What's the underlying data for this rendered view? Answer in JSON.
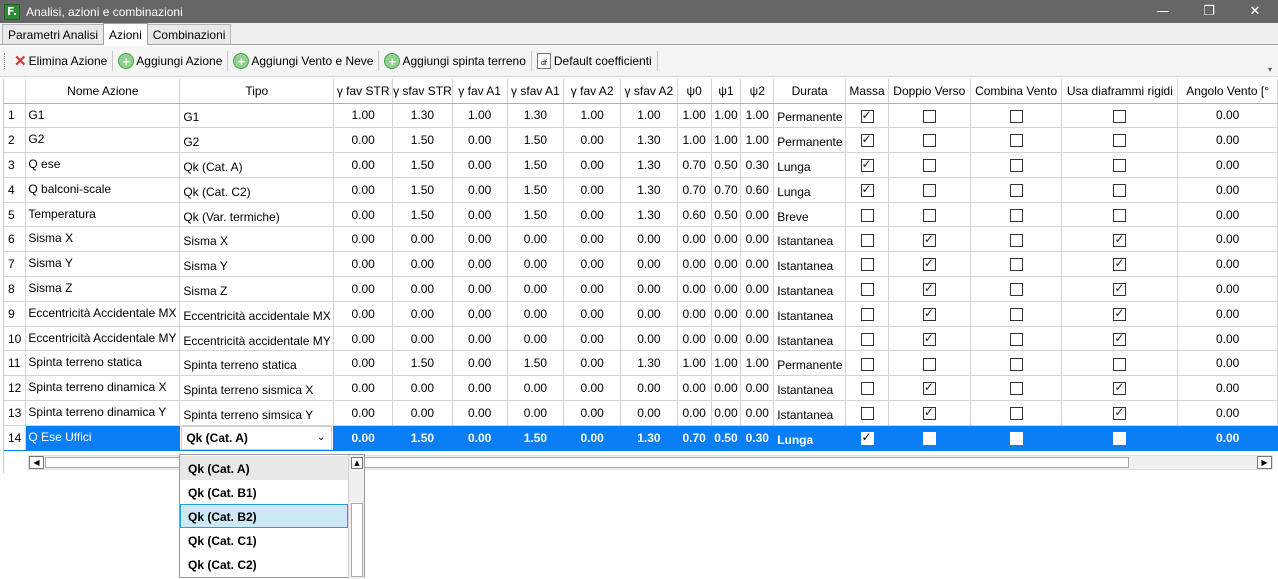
{
  "window": {
    "title": "Analisi, azioni e combinazioni",
    "app_icon": "F.",
    "minimize": "—",
    "restore": "❐",
    "close": "✕"
  },
  "tabs": [
    {
      "label": "Parametri Analisi",
      "active": false
    },
    {
      "label": "Azioni",
      "active": true
    },
    {
      "label": "Combinazioni",
      "active": false
    }
  ],
  "toolbar": {
    "delete_label": "Elimina Azione",
    "add_label": "Aggiungi Azione",
    "add_wind_label": "Aggiungi Vento e Neve",
    "add_soil_label": "Aggiungi spinta terreno",
    "default_label": "Default coefficienti",
    "more": "▾"
  },
  "columns": [
    "",
    "Nome Azione",
    "Tipo",
    "γ fav STR",
    "γ sfav STR",
    "γ fav A1",
    "γ sfav A1",
    "γ fav A2",
    "γ sfav A2",
    "ψ0",
    "ψ1",
    "ψ2",
    "Durata",
    "Massa",
    "Doppio Verso",
    "Combina Vento",
    "Usa diaframmi rigidi",
    "Angolo Vento [°"
  ],
  "rows": [
    {
      "idx": "1",
      "name": "G1",
      "tipo": "G1",
      "vals": [
        "1.00",
        "1.30",
        "1.00",
        "1.30",
        "1.00",
        "1.00",
        "1.00",
        "1.00",
        "1.00"
      ],
      "durata": "Permanente",
      "massa": true,
      "doppio": false,
      "vento": false,
      "diaframmi": false,
      "angolo": "0.00"
    },
    {
      "idx": "2",
      "name": "G2",
      "tipo": "G2",
      "vals": [
        "0.00",
        "1.50",
        "0.00",
        "1.50",
        "0.00",
        "1.30",
        "1.00",
        "1.00",
        "1.00"
      ],
      "durata": "Permanente",
      "massa": true,
      "doppio": false,
      "vento": false,
      "diaframmi": false,
      "angolo": "0.00"
    },
    {
      "idx": "3",
      "name": "Q ese",
      "tipo": "Qk (Cat. A)",
      "vals": [
        "0.00",
        "1.50",
        "0.00",
        "1.50",
        "0.00",
        "1.30",
        "0.70",
        "0.50",
        "0.30"
      ],
      "durata": "Lunga",
      "massa": true,
      "doppio": false,
      "vento": false,
      "diaframmi": false,
      "angolo": "0.00"
    },
    {
      "idx": "4",
      "name": "Q balconi-scale",
      "tipo": "Qk (Cat. C2)",
      "vals": [
        "0.00",
        "1.50",
        "0.00",
        "1.50",
        "0.00",
        "1.30",
        "0.70",
        "0.70",
        "0.60"
      ],
      "durata": "Lunga",
      "massa": true,
      "doppio": false,
      "vento": false,
      "diaframmi": false,
      "angolo": "0.00"
    },
    {
      "idx": "5",
      "name": "Temperatura",
      "tipo": "Qk (Var. termiche)",
      "vals": [
        "0.00",
        "1.50",
        "0.00",
        "1.50",
        "0.00",
        "1.30",
        "0.60",
        "0.50",
        "0.00"
      ],
      "durata": "Breve",
      "massa": false,
      "doppio": false,
      "vento": false,
      "diaframmi": false,
      "angolo": "0.00"
    },
    {
      "idx": "6",
      "name": "Sisma X",
      "tipo": "Sisma X",
      "vals": [
        "0.00",
        "0.00",
        "0.00",
        "0.00",
        "0.00",
        "0.00",
        "0.00",
        "0.00",
        "0.00"
      ],
      "durata": "Istantanea",
      "massa": false,
      "doppio": true,
      "vento": false,
      "diaframmi": true,
      "angolo": "0.00"
    },
    {
      "idx": "7",
      "name": "Sisma Y",
      "tipo": "Sisma Y",
      "vals": [
        "0.00",
        "0.00",
        "0.00",
        "0.00",
        "0.00",
        "0.00",
        "0.00",
        "0.00",
        "0.00"
      ],
      "durata": "Istantanea",
      "massa": false,
      "doppio": true,
      "vento": false,
      "diaframmi": true,
      "angolo": "0.00"
    },
    {
      "idx": "8",
      "name": "Sisma Z",
      "tipo": "Sisma Z",
      "vals": [
        "0.00",
        "0.00",
        "0.00",
        "0.00",
        "0.00",
        "0.00",
        "0.00",
        "0.00",
        "0.00"
      ],
      "durata": "Istantanea",
      "massa": false,
      "doppio": true,
      "vento": false,
      "diaframmi": true,
      "angolo": "0.00"
    },
    {
      "idx": "9",
      "name": "Eccentricità Accidentale MX",
      "tipo": "Eccentricità accidentale MX",
      "vals": [
        "0.00",
        "0.00",
        "0.00",
        "0.00",
        "0.00",
        "0.00",
        "0.00",
        "0.00",
        "0.00"
      ],
      "durata": "Istantanea",
      "massa": false,
      "doppio": true,
      "vento": false,
      "diaframmi": true,
      "angolo": "0.00"
    },
    {
      "idx": "10",
      "name": "Eccentricità Accidentale MY",
      "tipo": "Eccentricità accidentale MY",
      "vals": [
        "0.00",
        "0.00",
        "0.00",
        "0.00",
        "0.00",
        "0.00",
        "0.00",
        "0.00",
        "0.00"
      ],
      "durata": "Istantanea",
      "massa": false,
      "doppio": true,
      "vento": false,
      "diaframmi": true,
      "angolo": "0.00"
    },
    {
      "idx": "11",
      "name": "Spinta terreno statica",
      "tipo": "Spinta terreno statica",
      "vals": [
        "0.00",
        "1.50",
        "0.00",
        "1.50",
        "0.00",
        "1.30",
        "1.00",
        "1.00",
        "1.00"
      ],
      "durata": "Permanente",
      "massa": false,
      "doppio": false,
      "vento": false,
      "diaframmi": false,
      "angolo": "0.00"
    },
    {
      "idx": "12",
      "name": "Spinta terreno dinamica X",
      "tipo": "Spinta terreno sismica X",
      "vals": [
        "0.00",
        "0.00",
        "0.00",
        "0.00",
        "0.00",
        "0.00",
        "0.00",
        "0.00",
        "0.00"
      ],
      "durata": "Istantanea",
      "massa": false,
      "doppio": true,
      "vento": false,
      "diaframmi": true,
      "angolo": "0.00"
    },
    {
      "idx": "13",
      "name": "Spinta terreno dinamica Y",
      "tipo": "Spinta terreno simsica Y",
      "vals": [
        "0.00",
        "0.00",
        "0.00",
        "0.00",
        "0.00",
        "0.00",
        "0.00",
        "0.00",
        "0.00"
      ],
      "durata": "Istantanea",
      "massa": false,
      "doppio": true,
      "vento": false,
      "diaframmi": true,
      "angolo": "0.00"
    },
    {
      "idx": "14",
      "name": "Q Ese Uffici",
      "tipo": "Qk (Cat. A)",
      "vals": [
        "0.00",
        "1.50",
        "0.00",
        "1.50",
        "0.00",
        "1.30",
        "0.70",
        "0.50",
        "0.30"
      ],
      "durata": "Lunga",
      "massa": true,
      "doppio": false,
      "vento": false,
      "diaframmi": false,
      "angolo": "0.00",
      "selected": true
    }
  ],
  "dropdown": {
    "options": [
      "Qk (Cat. A)",
      "Qk (Cat. B1)",
      "Qk (Cat. B2)",
      "Qk (Cat. C1)",
      "Qk (Cat. C2)"
    ],
    "current_index": 0,
    "hover_index": 2
  }
}
